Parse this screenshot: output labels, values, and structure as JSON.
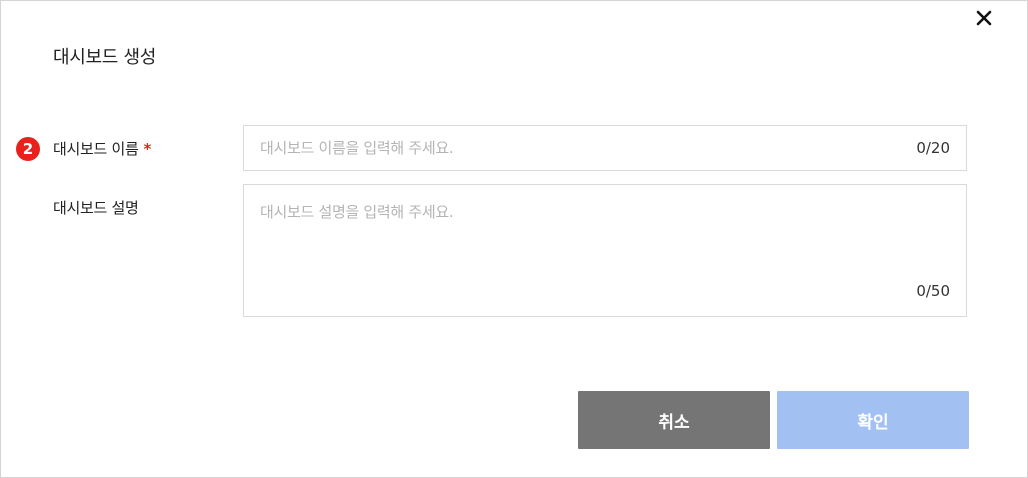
{
  "dialog": {
    "title": "대시보드 생성",
    "close_icon": "close-icon"
  },
  "form": {
    "step_number": "2",
    "name": {
      "label": "대시보드 이름",
      "required_mark": "*",
      "placeholder": "대시보드 이름을 입력해 주세요.",
      "value": "",
      "counter": "0/20"
    },
    "description": {
      "label": "대시보드 설명",
      "placeholder": "대시보드 설명을 입력해 주세요.",
      "value": "",
      "counter": "0/50"
    }
  },
  "buttons": {
    "cancel_label": "취소",
    "confirm_label": "확인"
  },
  "colors": {
    "required": "#e8211d",
    "cancel_bg": "#757575",
    "confirm_bg_disabled": "#a3c0f3"
  }
}
